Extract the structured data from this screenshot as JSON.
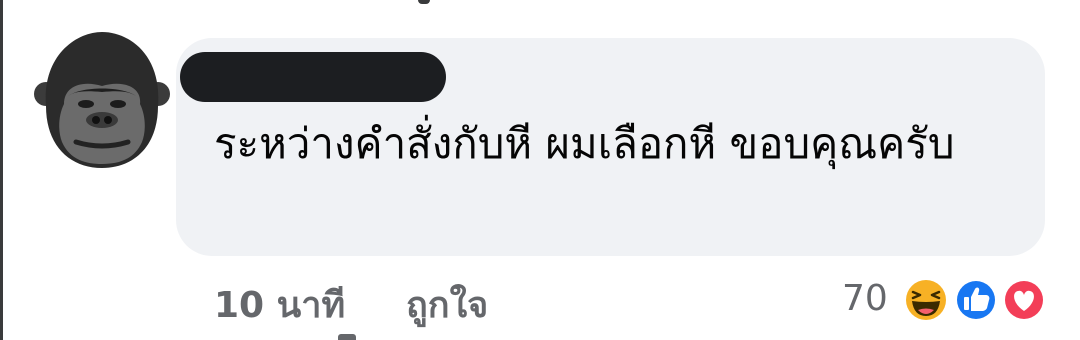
{
  "comment": {
    "author_name_redacted": true,
    "text": "ระหว่างคำสั่งกับหี ผมเลือกหี ขอบคุณครับ",
    "time": "10 นาที",
    "like_label": "ถูกใจ",
    "reaction_count": "70",
    "reactions": [
      "haha-icon",
      "like-icon",
      "love-icon"
    ]
  },
  "colors": {
    "bubble": "#f0f2f5",
    "meta_text": "#65676b",
    "like_blue": "#1877f2",
    "love_red": "#f33e58",
    "haha_yellow": "#f7b125"
  }
}
